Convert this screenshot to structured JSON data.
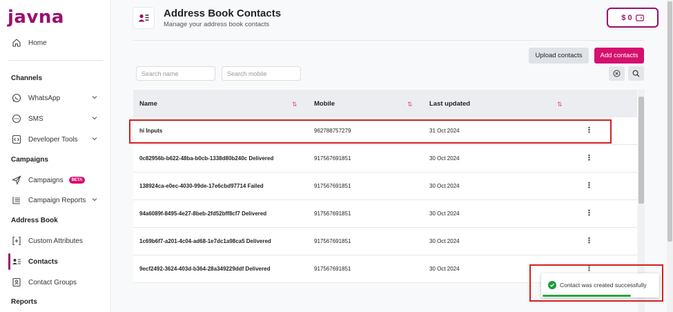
{
  "app": {
    "logo": "javna"
  },
  "sidebar": {
    "home": "Home",
    "channels_heading": "Channels",
    "whatsapp": "WhatsApp",
    "sms": "SMS",
    "developer_tools": "Developer Tools",
    "campaigns_heading": "Campaigns",
    "campaigns": "Campaigns",
    "beta_badge": "BETA",
    "campaign_reports": "Campaign Reports",
    "address_book_heading": "Address Book",
    "custom_attributes": "Custom Attributes",
    "contacts": "Contacts",
    "contact_groups": "Contact Groups",
    "reports_heading": "Reports"
  },
  "header": {
    "title": "Address Book Contacts",
    "subtitle": "Manage your address book contacts",
    "wallet_balance": "$ 0"
  },
  "toolbar": {
    "upload_label": "Upload contacts",
    "add_label": "Add contacts",
    "search_name_placeholder": "Search name",
    "search_mobile_placeholder": "Search mobile"
  },
  "table": {
    "columns": [
      "Name",
      "Mobile",
      "Last updated"
    ],
    "rows": [
      {
        "name": "hi Inputs",
        "mobile": "962788757279",
        "updated": "31 Oct 2024"
      },
      {
        "name": "0c82956b-b622-48ba-b0cb-1338d80b240c Delivered",
        "mobile": "917567691851",
        "updated": "30 Oct 2024"
      },
      {
        "name": "138924ca-e0ec-4030-99de-17e6cbd97714 Failed",
        "mobile": "917567691851",
        "updated": "30 Oct 2024"
      },
      {
        "name": "94a6089f-8495-4e27-8beb-2fd52bff8cf7 Delivered",
        "mobile": "917567691851",
        "updated": "30 Oct 2024"
      },
      {
        "name": "1c69b6f7-a201-4c04-ad68-1e7dc1a98ca5 Delivered",
        "mobile": "917567691851",
        "updated": "30 Oct 2024"
      },
      {
        "name": "9ecf2492-3624-403d-b364-28a349229ddf Delivered",
        "mobile": "917567691851",
        "updated": "30 Oct 2024"
      }
    ]
  },
  "toast": {
    "message": "Contact was created successfully"
  },
  "colors": {
    "brand": "#9b0f6e",
    "accent": "#d6106e",
    "success": "#1f9d3a",
    "annotation": "#d42020"
  }
}
